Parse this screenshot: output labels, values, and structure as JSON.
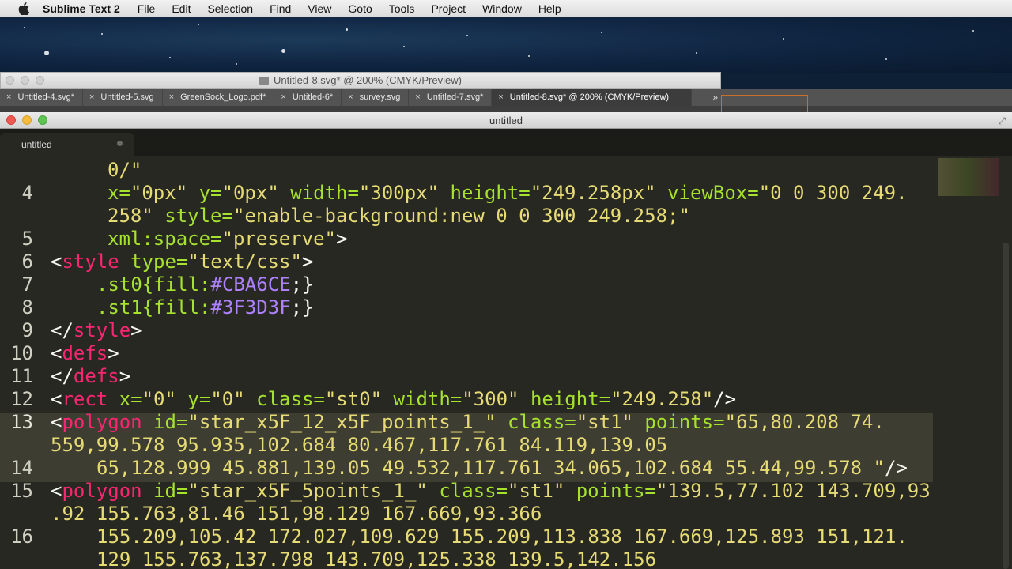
{
  "menubar": {
    "app": "Sublime Text 2",
    "items": [
      "File",
      "Edit",
      "Selection",
      "Find",
      "View",
      "Goto",
      "Tools",
      "Project",
      "Window",
      "Help"
    ]
  },
  "illustrator": {
    "title": "Untitled-8.svg* @ 200% (CMYK/Preview)",
    "tabs": [
      "Untitled-4.svg*",
      "Untitled-5.svg",
      "GreenSock_Logo.pdf*",
      "Untitled-6*",
      "survey.svg",
      "Untitled-7.svg*",
      "Untitled-8.svg* @ 200% (CMYK/Preview)"
    ],
    "active_tab": 6,
    "more_glyph": "»"
  },
  "sublime": {
    "title": "untitled",
    "tab_label": "untitled"
  },
  "line_numbers": [
    "4",
    "5",
    "6",
    "7",
    "8",
    "9",
    "10",
    "11",
    "12",
    "13",
    "14",
    "15",
    "16"
  ],
  "code": {
    "l3b": "0/\"",
    "l4a_x": "x=",
    "l4a_xv": "\"0px\"",
    "l4a_y": "y=",
    "l4a_yv": "\"0px\"",
    "l4a_w": "width=",
    "l4a_wv": "\"300px\"",
    "l4a_h": "height=",
    "l4a_hv": "\"249.258px\"",
    "l4a_vb": "viewBox=",
    "l4a_vbv": "\"0 0 300 249.",
    "l4b_v": "258\"",
    "l4b_st": "style=",
    "l4b_stv": "\"enable-background:new 0 0 300 249.258;\"",
    "l5_xs": "xml:space=",
    "l5_xsv": "\"preserve\"",
    "l5_end": ">",
    "l6_lt": "<",
    "l6_tag": "style",
    "l6_attr": "type=",
    "l6_val": "\"text/css\"",
    "l6_gt": ">",
    "l7_sel": ".st0{fill:",
    "l7_col": "#CBA6CE",
    "l7_end": ";}",
    "l8_sel": ".st1{fill:",
    "l8_col": "#3F3D3F",
    "l8_end": ";}",
    "l9_lt": "</",
    "l9_tag": "style",
    "l9_gt": ">",
    "l10_lt": "<",
    "l10_tag": "defs",
    "l10_gt": ">",
    "l11_lt": "</",
    "l11_tag": "defs",
    "l11_gt": ">",
    "l12_lt": "<",
    "l12_tag": "rect",
    "l12_x": "x=",
    "l12_xv": "\"0\"",
    "l12_y": "y=",
    "l12_yv": "\"0\"",
    "l12_c": "class=",
    "l12_cv": "\"st0\"",
    "l12_w": "width=",
    "l12_wv": "\"300\"",
    "l12_h": "height=",
    "l12_hv": "\"249.258\"",
    "l12_end": "/>",
    "l13_lt": "<",
    "l13_tag": "polygon",
    "l13_id": "id=",
    "l13_idv": "\"star_x5F_12_x5F_points_1_\"",
    "l13_c": "class=",
    "l13_cv": "\"st1\"",
    "l13_p": "points=",
    "l13_pv": "\"65,80.208 74.",
    "l13b": "559,99.578 95.935,102.684 80.467,117.761 84.119,139.05",
    "l13c": "65,128.999 45.881,139.05 49.532,117.761 34.065,102.684 55.44,99.578 \"",
    "l13c_end": "/>",
    "l15_lt": "<",
    "l15_tag": "polygon",
    "l15_id": "id=",
    "l15_idv": "\"star_x5F_5points_1_\"",
    "l15_c": "class=",
    "l15_cv": "\"st1\"",
    "l15_p": "points=",
    "l15_pv": "\"139.5,77.102 143.709,93",
    "l15b": ".92 155.763,81.46 151,98.129 167.669,93.366",
    "l16a": "155.209,105.42 172.027,109.629 155.209,113.838 167.669,125.893 151,121.",
    "l16b": "129 155.763,137.798 143.709,125.338 139.5,142.156"
  }
}
